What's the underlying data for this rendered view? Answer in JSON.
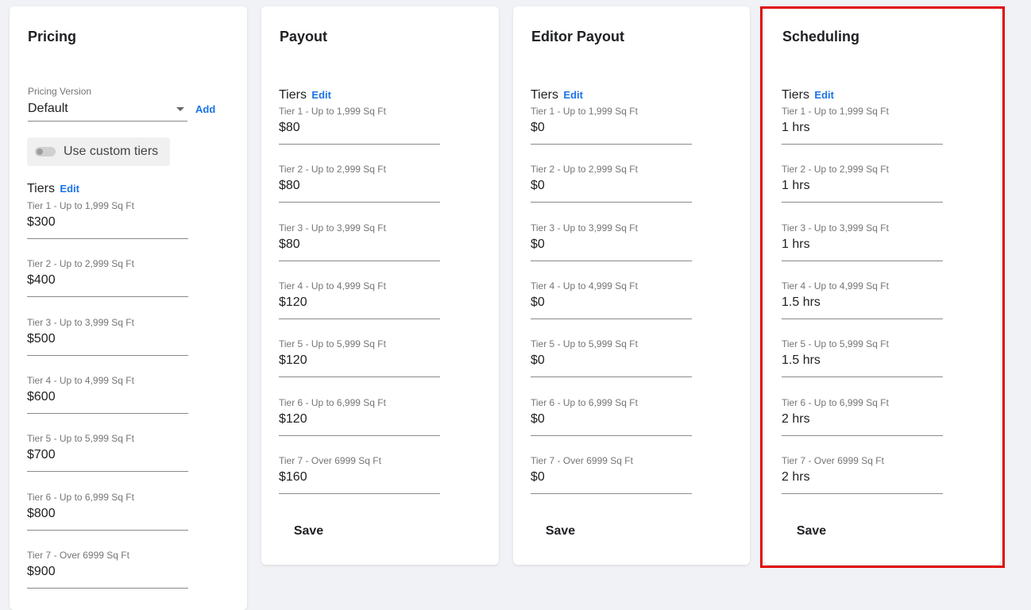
{
  "colors": {
    "accent": "#1a73e8",
    "highlight": "#e00a0a"
  },
  "pricing": {
    "title": "Pricing",
    "version_label": "Pricing Version",
    "version_value": "Default",
    "add_label": "Add",
    "toggle_label": "Use custom tiers",
    "toggle_on": false,
    "tiers_label": "Tiers",
    "edit_label": "Edit",
    "tiers": [
      {
        "label": "Tier 1 - Up to 1,999 Sq Ft",
        "value": "$300"
      },
      {
        "label": "Tier 2 - Up to 2,999 Sq Ft",
        "value": "$400"
      },
      {
        "label": "Tier 3 - Up to 3,999 Sq Ft",
        "value": "$500"
      },
      {
        "label": "Tier 4 - Up to 4,999 Sq Ft",
        "value": "$600"
      },
      {
        "label": "Tier 5 - Up to 5,999 Sq Ft",
        "value": "$700"
      },
      {
        "label": "Tier 6 - Up to 6,999 Sq Ft",
        "value": "$800"
      },
      {
        "label": "Tier 7 - Over 6999 Sq Ft",
        "value": "$900"
      }
    ]
  },
  "payout": {
    "title": "Payout",
    "tiers_label": "Tiers",
    "edit_label": "Edit",
    "save_label": "Save",
    "tiers": [
      {
        "label": "Tier 1 - Up to 1,999 Sq Ft",
        "value": "$80"
      },
      {
        "label": "Tier 2 - Up to 2,999 Sq Ft",
        "value": "$80"
      },
      {
        "label": "Tier 3 - Up to 3,999 Sq Ft",
        "value": "$80"
      },
      {
        "label": "Tier 4 - Up to 4,999 Sq Ft",
        "value": "$120"
      },
      {
        "label": "Tier 5 - Up to 5,999 Sq Ft",
        "value": "$120"
      },
      {
        "label": "Tier 6 - Up to 6,999 Sq Ft",
        "value": "$120"
      },
      {
        "label": "Tier 7 - Over 6999 Sq Ft",
        "value": "$160"
      }
    ]
  },
  "editor_payout": {
    "title": "Editor Payout",
    "tiers_label": "Tiers",
    "edit_label": "Edit",
    "save_label": "Save",
    "tiers": [
      {
        "label": "Tier 1 - Up to 1,999 Sq Ft",
        "value": "$0"
      },
      {
        "label": "Tier 2 - Up to 2,999 Sq Ft",
        "value": "$0"
      },
      {
        "label": "Tier 3 - Up to 3,999 Sq Ft",
        "value": "$0"
      },
      {
        "label": "Tier 4 - Up to 4,999 Sq Ft",
        "value": "$0"
      },
      {
        "label": "Tier 5 - Up to 5,999 Sq Ft",
        "value": "$0"
      },
      {
        "label": "Tier 6 - Up to 6,999 Sq Ft",
        "value": "$0"
      },
      {
        "label": "Tier 7 - Over 6999 Sq Ft",
        "value": "$0"
      }
    ]
  },
  "scheduling": {
    "title": "Scheduling",
    "tiers_label": "Tiers",
    "edit_label": "Edit",
    "save_label": "Save",
    "tiers": [
      {
        "label": "Tier 1 - Up to 1,999 Sq Ft",
        "value": "1 hrs"
      },
      {
        "label": "Tier 2 - Up to 2,999 Sq Ft",
        "value": "1 hrs"
      },
      {
        "label": "Tier 3 - Up to 3,999 Sq Ft",
        "value": "1 hrs"
      },
      {
        "label": "Tier 4 - Up to 4,999 Sq Ft",
        "value": "1.5 hrs"
      },
      {
        "label": "Tier 5 - Up to 5,999 Sq Ft",
        "value": "1.5 hrs"
      },
      {
        "label": "Tier 6 - Up to 6,999 Sq Ft",
        "value": "2 hrs"
      },
      {
        "label": "Tier 7 - Over 6999 Sq Ft",
        "value": "2 hrs"
      }
    ]
  }
}
